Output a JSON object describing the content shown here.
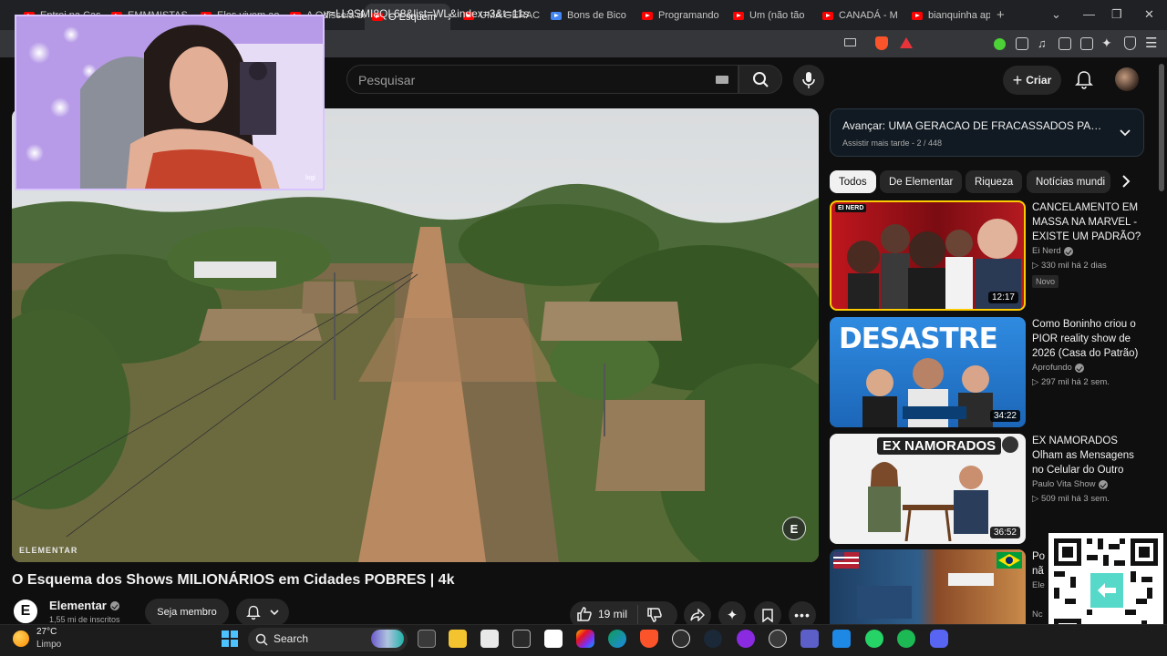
{
  "browser": {
    "tabs": [
      {
        "label": "Entrei na Cas",
        "icon": "youtube-icon"
      },
      {
        "label": "EMMMISTAS",
        "icon": "youtube-icon"
      },
      {
        "label": "Eles vivem ao",
        "icon": "youtube-icon"
      },
      {
        "label": "A Odisseia do",
        "icon": "youtube-icon"
      },
      {
        "label": "O Esquem",
        "icon": "youtube-icon",
        "active": true
      },
      {
        "label": "UMA GERACA",
        "icon": "youtube-icon"
      },
      {
        "label": "Bons de Bico",
        "icon": "translate-icon"
      },
      {
        "label": "Programando",
        "icon": "youtube-icon"
      },
      {
        "label": "Um (não tão",
        "icon": "youtube-icon"
      },
      {
        "label": "CANADÁ - M",
        "icon": "youtube-icon"
      },
      {
        "label": "bianquinha ap",
        "icon": "youtube-icon"
      }
    ],
    "new_tab": "+",
    "url": "v=LL9SMI8QL68&list=WL&index=3&t=11s"
  },
  "header": {
    "search_placeholder": "Pesquisar",
    "create_label": "Criar"
  },
  "video": {
    "watermark": "ELEMENTAR",
    "logo_letter": "E",
    "title": "O Esquema dos Shows MILIONÁRIOS em Cidades POBRES | 4k",
    "channel": "Elementar",
    "channel_initial": "E",
    "subscribers": "1,55 mi de inscritos",
    "join_label": "Seja membro",
    "likes": "19 mil"
  },
  "webcam": {
    "logo": "logi"
  },
  "playlist": {
    "next_label": "Avançar: UMA GERACAO DE FRACASSADOS PASS...",
    "list_info": "Assistir mais tarde - 2 / 448"
  },
  "chips": [
    "Todos",
    "De Elementar",
    "Riqueza",
    "Notícias mundi"
  ],
  "recommendations": [
    {
      "title": "CANCELAMENTO EM MASSA NA MARVEL - EXISTE UM PADRÃO?",
      "channel": "Ei Nerd",
      "meta": "▷ 330 mil   há 2 dias",
      "badge": "Novo",
      "duration": "12:17",
      "thumb_text": "EI NERD"
    },
    {
      "title": "Como Boninho criou o PIOR reality show de 2026 (Casa do Patrão)",
      "channel": "Aprofundo",
      "meta": "▷ 297 mil   há 2 sem.",
      "duration": "34:22",
      "thumb_text": "DESASTRE"
    },
    {
      "title": "EX NAMORADOS Olham as Mensagens no Celular do Outro",
      "channel": "Paulo Vita Show",
      "meta": "▷ 509 mil   há 3 sem.",
      "duration": "36:52",
      "thumb_text": "EX NAMORADOS"
    },
    {
      "title": "Po nã",
      "channel": "Ele",
      "meta": "Nc"
    }
  ],
  "taskbar": {
    "temperature": "27°C",
    "weather": "Limpo",
    "search_label": "Search"
  },
  "colors": {
    "background": "#0f0f0f",
    "youtube_red": "#ff0000",
    "chip_active": "#f1f1f1",
    "webcam_border": "#d9c4ff"
  }
}
